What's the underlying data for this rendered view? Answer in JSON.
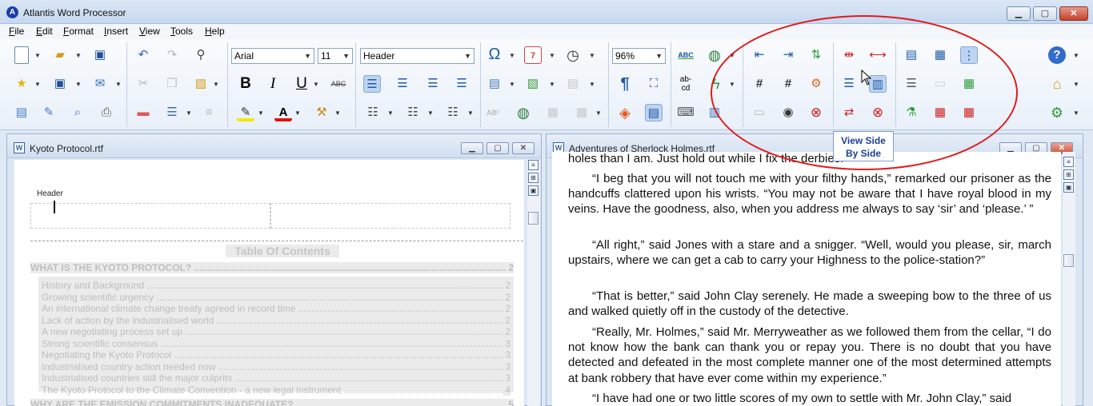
{
  "app": {
    "title": "Atlantis Word Processor",
    "logo": "A",
    "minimize": "▁",
    "maximize": "▢",
    "close": "✕"
  },
  "menu": [
    "File",
    "Edit",
    "Format",
    "Insert",
    "View",
    "Tools",
    "Help"
  ],
  "toolbar": {
    "font_name": "Arial",
    "font_size": "11",
    "style": "Header",
    "zoom": "96%",
    "bold": "B",
    "italic": "I",
    "underline": "U",
    "strike": "ABC",
    "show_marks": "¶",
    "spell_abc": "ABC",
    "abcd": "ab-cd",
    "ab1": "AB¹",
    "omega": "Ω",
    "calendar": "7",
    "hash": "#",
    "tooltip_line1": "View Side",
    "tooltip_line2": "By Side"
  },
  "colors": {
    "accent": "#1f5aa6",
    "highlight_circle": "#e11b1b",
    "tooltip_text": "#1a3f95"
  },
  "left_doc": {
    "title": "Kyoto Protocol.rtf",
    "header_label": "Header",
    "toc_title": "Table Of Contents",
    "toc_main": [
      {
        "text": "WHAT IS THE KYOTO PROTOCOL? ........................................................................................................................................",
        "page": "2"
      },
      {
        "text": "WHY ARE THE EMISSION COMMITMENTS INADEQUATE?",
        "page": "5"
      }
    ],
    "toc_items": [
      {
        "text": "History and Background ............................................................................................................................................................",
        "page": "2"
      },
      {
        "text": "Growing scientific urgency ........................................................................................................................................................",
        "page": "2"
      },
      {
        "text": "An international climate change treaty agreed in record time ...................................................................................................",
        "page": "2"
      },
      {
        "text": "Lack of action by the industrialised world ..................................................................................................................................",
        "page": "2"
      },
      {
        "text": "A new negotiating process set up ..............................................................................................................................................",
        "page": "2"
      },
      {
        "text": "Strong scientific consensus .......................................................................................................................................................",
        "page": "3"
      },
      {
        "text": "Negotiating the Kyoto Protocol .................................................................................................................................................",
        "page": "3"
      },
      {
        "text": "Industrialised country action needed now ................................................................................................................................",
        "page": "3"
      },
      {
        "text": "Industrialised countries still the major culprits ..........................................................................................................................",
        "page": "3"
      },
      {
        "text": "The Kyoto Protocol to the Climate Convention - a new legal instrument ......................................................................................",
        "page": "4"
      }
    ]
  },
  "right_doc": {
    "title": "Adventures of Sherlock Holmes.rtf",
    "paragraphs": [
      "holes than I am. Just hold out while I fix the derbies.”",
      "“I beg that you will not touch me with your filthy hands,” remarked our prisoner as the handcuffs clattered upon his wrists. “You may not be aware that I have royal blood in my veins. Have the goodness, also, when you address me always to say ‘sir’ and ‘please.’ ”",
      "“All right,” said Jones with a stare and a snigger. “Well, would you please, sir, march upstairs, where we can get a cab to carry your Highness to the police-station?”",
      "“That is better,” said John Clay serenely. He made a sweeping bow to the three of us and walked quietly off in the custody of the detective.",
      "“Really, Mr. Holmes,” said Mr. Merryweather as we followed them from the cellar, “I do not know how the bank can thank you or repay you. There is no doubt that you have detected and defeated in the most complete manner one of the most determined attempts at bank robbery that have ever come within my experience.”",
      "“I have had one or two little scores of my own to settle with Mr. John Clay,” said"
    ]
  }
}
